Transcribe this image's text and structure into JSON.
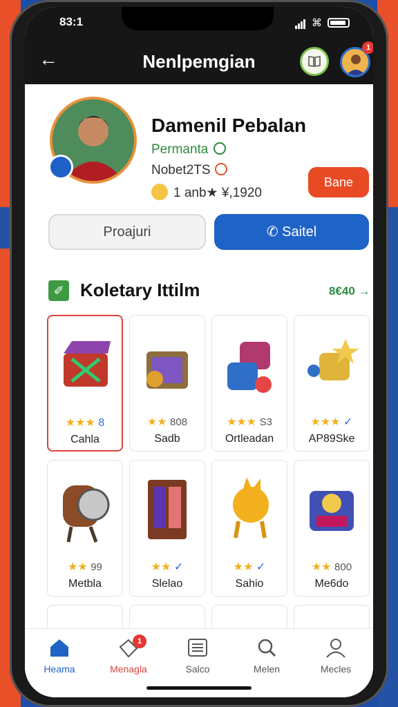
{
  "status_bar": {
    "time": "83:1"
  },
  "header": {
    "title": "Nenlpemgian",
    "back_icon": "arrow-left-icon",
    "notification_count": "1"
  },
  "profile": {
    "name": "Damenil Pebalan",
    "status": "Permanta",
    "note": "Nobet2TS",
    "rating": "1 anb★ ¥,1920",
    "action_label": "Bane"
  },
  "actions": {
    "secondary_label": "Proajuri",
    "primary_label": "Saitel"
  },
  "section": {
    "title": "Koletary Ittilm",
    "link": "8€40"
  },
  "items": [
    {
      "name": "Cahla",
      "stars": "★★★",
      "extra": "8"
    },
    {
      "name": "Sadb",
      "stars": "★★",
      "extra": "808"
    },
    {
      "name": "Ortleadan",
      "stars": "★★★",
      "extra": "S3"
    },
    {
      "name": "AP89Ske",
      "stars": "★★★",
      "extra": "✓"
    },
    {
      "name": "Metbla",
      "stars": "★★",
      "extra": "99"
    },
    {
      "name": "Slelao",
      "stars": "★★",
      "extra": "✓"
    },
    {
      "name": "Sahio",
      "stars": "★★",
      "extra": "✓"
    },
    {
      "name": "Me6do",
      "stars": "★★",
      "extra": "800"
    }
  ],
  "tabs": [
    {
      "label": "Heama",
      "icon": "home-icon"
    },
    {
      "label": "Menagla",
      "icon": "tag-icon",
      "badge": "1"
    },
    {
      "label": "Salco",
      "icon": "list-icon"
    },
    {
      "label": "Melen",
      "icon": "search-icon"
    },
    {
      "label": "Mecles",
      "icon": "user-icon"
    }
  ],
  "colors": {
    "accent": "#1f63c6",
    "danger": "#e84a24",
    "success": "#2e8b3e"
  }
}
